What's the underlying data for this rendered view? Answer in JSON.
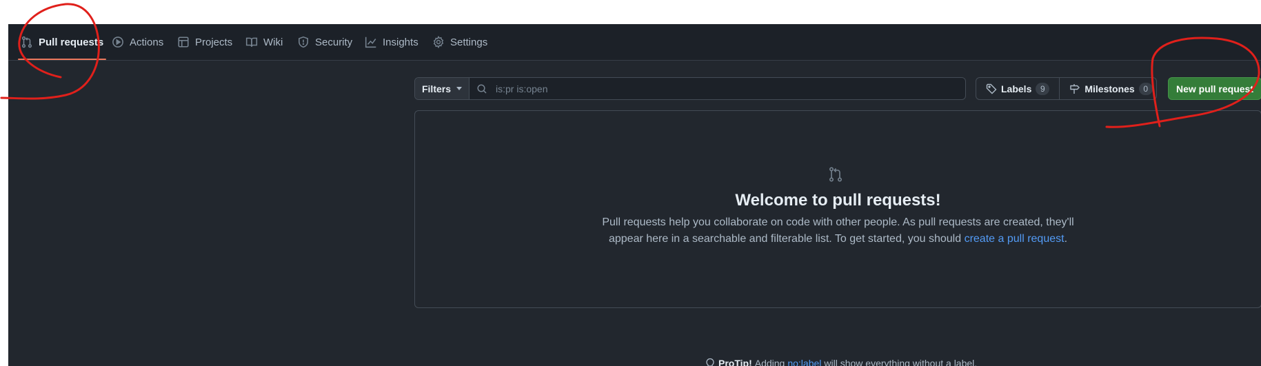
{
  "nav": {
    "tabs": [
      {
        "label": "Pull requests",
        "icon": "pull-request-icon",
        "active": true
      },
      {
        "label": "Actions",
        "icon": "play-icon"
      },
      {
        "label": "Projects",
        "icon": "table-icon"
      },
      {
        "label": "Wiki",
        "icon": "book-icon"
      },
      {
        "label": "Security",
        "icon": "shield-icon"
      },
      {
        "label": "Insights",
        "icon": "graph-icon"
      },
      {
        "label": "Settings",
        "icon": "gear-icon"
      }
    ]
  },
  "toolbar": {
    "filters_label": "Filters",
    "search_value": "is:pr is:open",
    "labels_label": "Labels",
    "labels_count": "9",
    "milestones_label": "Milestones",
    "milestones_count": "0",
    "new_pr_label": "New pull request"
  },
  "blankslate": {
    "title": "Welcome to pull requests!",
    "desc_line1": "Pull requests help you collaborate on code with other people. As pull requests are created, they'll",
    "desc_line2": "appear here in a searchable and filterable list. To get started, you should",
    "link": "create a pull request",
    "end": "."
  },
  "protip": {
    "strong": "ProTip!",
    "pre": "Adding",
    "link": "no:label",
    "post": "will show everything without a label."
  },
  "colors": {
    "accent_green": "#347d39",
    "annotation_red": "#e0201b",
    "active_underline": "#ec775c"
  }
}
